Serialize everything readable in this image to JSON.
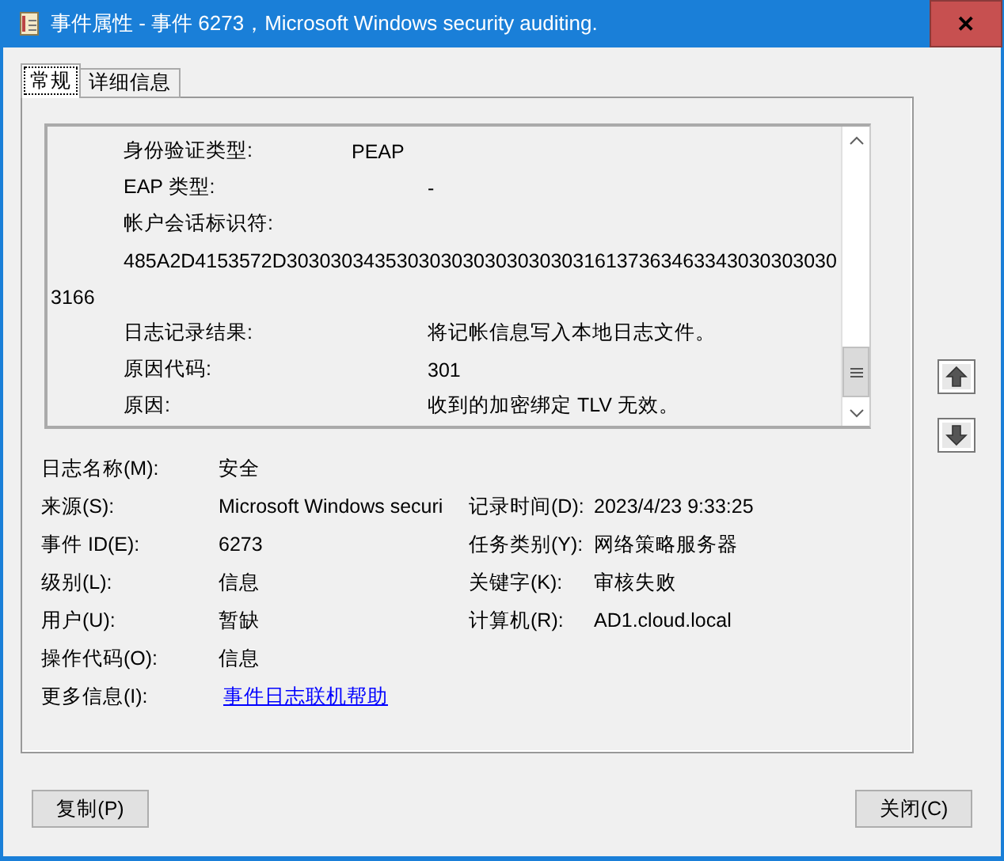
{
  "window": {
    "title": "事件属性 - 事件 6273，Microsoft Windows security auditing.",
    "close": "✕"
  },
  "tabs": [
    {
      "label": "常规",
      "selected": true
    },
    {
      "label": "详细信息",
      "selected": false
    }
  ],
  "details": [
    {
      "kind": "pair_near",
      "label": "身份验证类型:",
      "value": "PEAP"
    },
    {
      "kind": "pair",
      "label": "EAP 类型:",
      "value": "-"
    },
    {
      "kind": "heading",
      "label": "帐户会话标识符:"
    },
    {
      "kind": "indented",
      "text": "485A2D4153572D30303034353030303030303030316137363463343030303030"
    },
    {
      "kind": "flush",
      "text": "3166"
    },
    {
      "kind": "pair",
      "label": "日志记录结果:",
      "value": "将记帐信息写入本地日志文件。"
    },
    {
      "kind": "pair",
      "label": "原因代码:",
      "value": "301"
    },
    {
      "kind": "pair",
      "label": "原因:",
      "value": "收到的加密绑定 TLV 无效。"
    }
  ],
  "fields": [
    {
      "label": "日志名称(M):",
      "value": "安全"
    },
    {
      "label": "来源(S):",
      "value": "Microsoft Windows securi",
      "label2": "记录时间(D):",
      "value2": "2023/4/23 9:33:25"
    },
    {
      "label": "事件 ID(E):",
      "value": "6273",
      "label2": "任务类别(Y):",
      "value2": "网络策略服务器"
    },
    {
      "label": "级别(L):",
      "value": "信息",
      "label2": "关键字(K):",
      "value2": "审核失败"
    },
    {
      "label": "用户(U):",
      "value": "暂缺",
      "label2": "计算机(R):",
      "value2": "AD1.cloud.local"
    },
    {
      "label": "操作代码(O):",
      "value": "信息"
    },
    {
      "label": "更多信息(I):",
      "link": "事件日志联机帮助"
    }
  ],
  "buttons": {
    "copy": "复制(P)",
    "close": "关闭(C)"
  }
}
